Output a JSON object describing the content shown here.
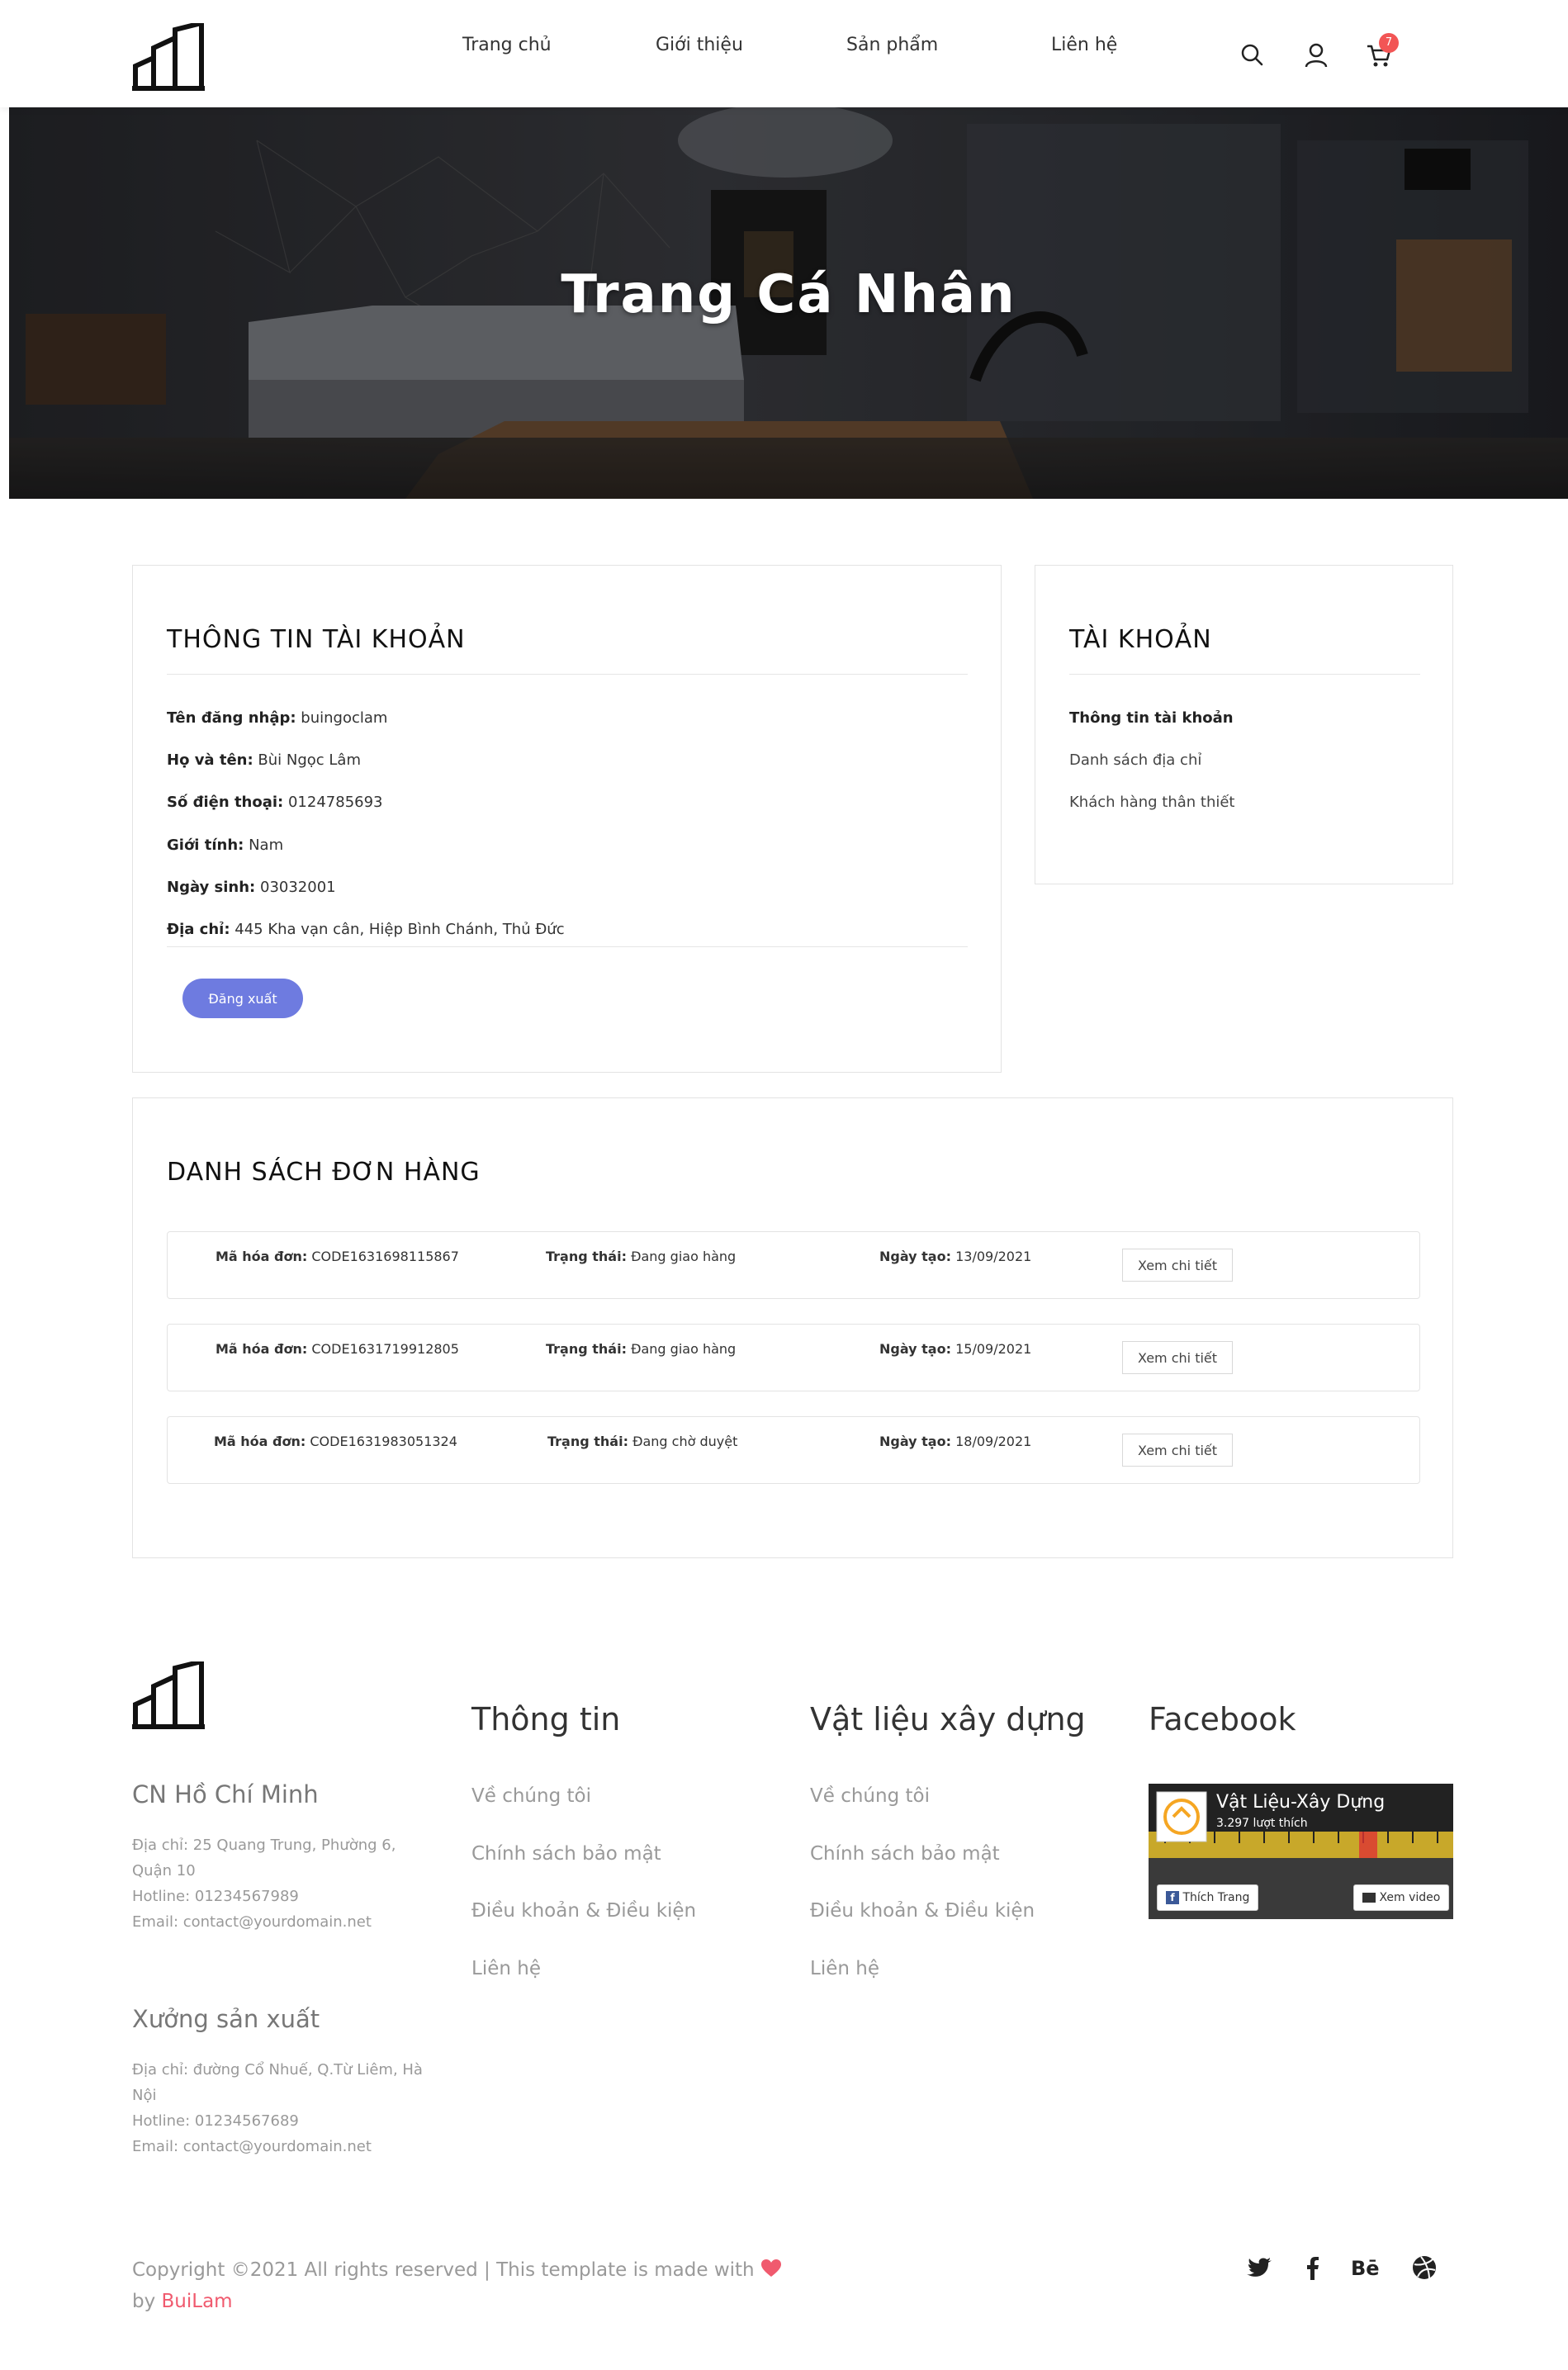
{
  "header": {
    "nav": [
      "Trang chủ",
      "Giới thiệu",
      "Sản phẩm",
      "Liên hệ"
    ],
    "cart_count": "7"
  },
  "hero": {
    "title": "Trang Cá Nhân"
  },
  "account_info": {
    "title": "THÔNG TIN TÀI KHOẢN",
    "rows": [
      {
        "label": "Tên đăng nhập:",
        "value": "buingoclam"
      },
      {
        "label": "Họ và tên:",
        "value": "Bùi Ngọc Lâm"
      },
      {
        "label": "Số điện thoại:",
        "value": "0124785693"
      },
      {
        "label": "Giới tính:",
        "value": "Nam"
      },
      {
        "label": "Ngày sinh:",
        "value": "03032001"
      },
      {
        "label": "Địa chỉ:",
        "value": "445 Kha vạn cân, Hiệp Bình Chánh, Thủ Đức"
      }
    ],
    "logout_label": "Đăng xuất"
  },
  "account_menu": {
    "title": "TÀI KHOẢN",
    "items": [
      "Thông tin tài khoản",
      "Danh sách địa chỉ",
      "Khách hàng thân thiết"
    ]
  },
  "orders": {
    "title": "DANH SÁCH ĐƠN HÀNG",
    "code_label": "Mã hóa đơn:",
    "status_label": "Trạng thái:",
    "date_label": "Ngày tạo:",
    "view_label": "Xem chi tiết",
    "items": [
      {
        "code": "CODE1631698115867",
        "status": "Đang giao hàng",
        "date": "13/09/2021"
      },
      {
        "code": "CODE1631719912805",
        "status": "Đang giao hàng",
        "date": "15/09/2021"
      },
      {
        "code": "CODE1631983051324",
        "status": "Đang chờ duyệt",
        "date": "18/09/2021"
      }
    ]
  },
  "footer": {
    "branch1": {
      "name": "CN Hồ Chí Minh",
      "address": "Địa chỉ: 25 Quang Trung, Phường 6, Quận 10",
      "hotline": "Hotline: 01234567989",
      "email": "Email: contact@yourdomain.net"
    },
    "branch2": {
      "name": "Xưởng sản xuất",
      "address": "Địa chỉ: đường Cổ Nhuế, Q.Từ Liêm, Hà Nội",
      "hotline": "Hotline: 01234567689",
      "email": "Email: contact@yourdomain.net"
    },
    "col1": {
      "title": "Thông tin",
      "links": [
        "Về chúng tôi",
        "Chính sách bảo mật",
        "Điều khoản & Điều kiện",
        "Liên hệ"
      ]
    },
    "col2": {
      "title": "Vật liệu xây dựng",
      "links": [
        "Về chúng tôi",
        "Chính sách bảo mật",
        "Điều khoản & Điều kiện",
        "Liên hệ"
      ]
    },
    "facebook": {
      "title": "Facebook",
      "page_name": "Vật Liệu-Xây Dựng",
      "likes": "3.297 lượt thích",
      "like_button": "Thích Trang",
      "video_button": "Xem video"
    },
    "copyright": "Copyright ©2021 All rights reserved | This template is made with",
    "by": "by",
    "author": "BuiLam",
    "heart_color": "#f05a6e",
    "social_icons": [
      "twitter-icon",
      "facebook-icon",
      "behance-icon",
      "dribbble-icon"
    ]
  }
}
